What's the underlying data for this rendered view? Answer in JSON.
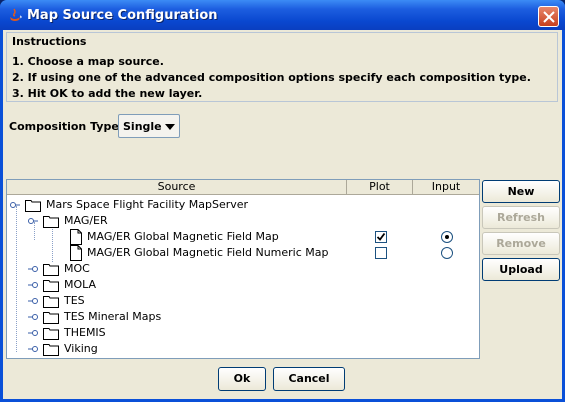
{
  "window": {
    "title": "Map Source Configuration"
  },
  "instructions": {
    "title": "Instructions",
    "lines": [
      "1. Choose a map source.",
      "2. If using one of the advanced composition options specify each composition type.",
      "3. Hit OK to add the new layer."
    ]
  },
  "composition": {
    "label": "Composition Type:",
    "selected": "Single"
  },
  "table": {
    "columns": [
      "Source",
      "Plot",
      "Input"
    ],
    "root": "Mars Space Flight Facility MapServer",
    "group": "MAG/ER",
    "items": [
      {
        "label": "MAG/ER Global Magnetic Field Map",
        "plot": true,
        "input": true
      },
      {
        "label": "MAG/ER Global Magnetic Field Numeric Map",
        "plot": false,
        "input": false
      }
    ],
    "folders": [
      "MOC",
      "MOLA",
      "TES",
      "TES Mineral Maps",
      "THEMIS",
      "Viking"
    ]
  },
  "side_buttons": {
    "new": "New",
    "refresh": "Refresh",
    "remove": "Remove",
    "upload": "Upload"
  },
  "footer": {
    "ok": "Ok",
    "cancel": "Cancel"
  },
  "colors": {
    "titlebar": "#0a48d0",
    "dialog_bg": "#ece9d8",
    "close": "#c8401e"
  }
}
